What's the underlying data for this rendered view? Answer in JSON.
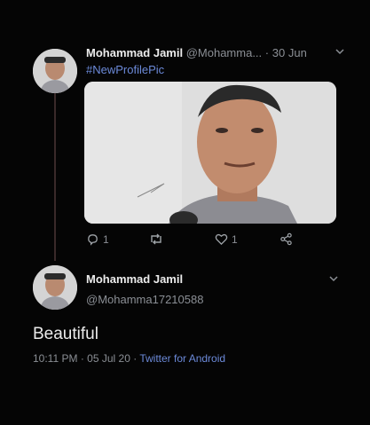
{
  "tweet1": {
    "author_name": "Mohammad Jamil",
    "handle": "@Mohamma...",
    "separator": "·",
    "date": "30 Jun",
    "hashtag": "#NewProfilePic",
    "actions": {
      "reply_count": "1",
      "retweet_count": "",
      "like_count": "1"
    },
    "icons": [
      "reply-icon",
      "retweet-icon",
      "like-icon",
      "share-icon",
      "chevron-down-icon"
    ]
  },
  "tweet2": {
    "author_name": "Mohammad Jamil",
    "handle": "@Mohamma17210588",
    "text": "Beautiful",
    "time": "10:11 PM",
    "date": "05 Jul 20",
    "separator": "·",
    "source": "Twitter for Android"
  },
  "colors": {
    "background": "#050505",
    "link": "#6c8ad9",
    "muted": "#8b8f95",
    "text": "#ececec"
  }
}
